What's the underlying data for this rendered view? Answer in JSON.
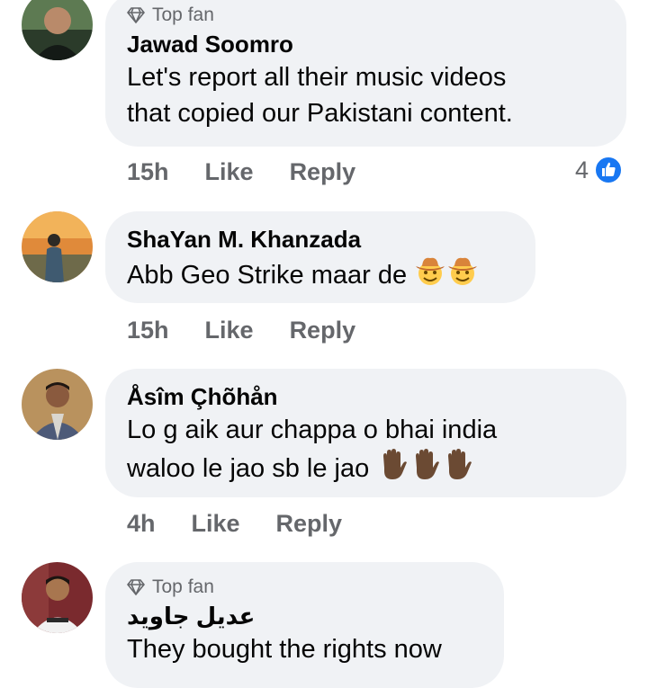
{
  "comments": [
    {
      "badge": "Top fan",
      "author": "Jawad Soomro",
      "text_lines": [
        "Let's report all their music videos",
        "that copied our Pakistani content."
      ],
      "time": "15h",
      "like_label": "Like",
      "reply_label": "Reply",
      "reaction_count": "4"
    },
    {
      "author": "ShaYan M. Khanzada",
      "text_lines": [
        "Abb Geo Strike maar de"
      ],
      "emojis": [
        "cowboy-face",
        "cowboy-face"
      ],
      "time": "15h",
      "like_label": "Like",
      "reply_label": "Reply"
    },
    {
      "author": "Åsîm Çhõhån",
      "text_lines": [
        "Lo g aik aur chappa o bhai india",
        "waloo le jao sb le jao"
      ],
      "emojis": [
        "raised-hand",
        "raised-hand",
        "raised-hand"
      ],
      "time": "4h",
      "like_label": "Like",
      "reply_label": "Reply"
    },
    {
      "badge": "Top fan",
      "author": "عديل جاويد",
      "text_lines": [
        "They bought the rights now"
      ]
    }
  ],
  "colors": {
    "bubble": "#f0f2f5",
    "meta_text": "#65676b",
    "like_blue": "#1877f2"
  }
}
